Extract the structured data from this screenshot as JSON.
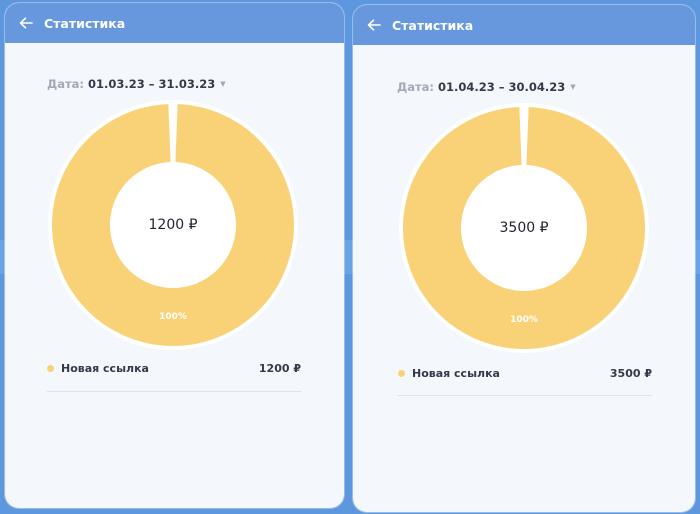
{
  "cards": [
    {
      "header": {
        "title": "Статистика",
        "back_icon": "arrow-left-icon"
      },
      "date": {
        "label": "Дата:",
        "range": "01.03.23 – 31.03.23"
      },
      "total": "1200 ₽",
      "chart_data": {
        "type": "pie",
        "categories": [
          "Новая ссылка"
        ],
        "values": [
          1200
        ],
        "percent_labels": [
          "100%"
        ]
      },
      "legend": [
        {
          "name": "Новая ссылка",
          "amount": "1200 ₽",
          "color": "#f9d278"
        }
      ]
    },
    {
      "header": {
        "title": "Статистика",
        "back_icon": "arrow-left-icon"
      },
      "date": {
        "label": "Дата:",
        "range": "01.04.23 – 30.04.23"
      },
      "total": "3500 ₽",
      "chart_data": {
        "type": "pie",
        "categories": [
          "Новая ссылка"
        ],
        "values": [
          3500
        ],
        "percent_labels": [
          "100%"
        ]
      },
      "legend": [
        {
          "name": "Новая ссылка",
          "amount": "3500 ₽",
          "color": "#f9d278"
        }
      ]
    }
  ],
  "colors": {
    "background": "#5d98df",
    "header": "#6797dc",
    "card": "#f4f7fb",
    "slice": "#f9d278",
    "text": "#333a4a",
    "muted": "#a3a9b6"
  }
}
